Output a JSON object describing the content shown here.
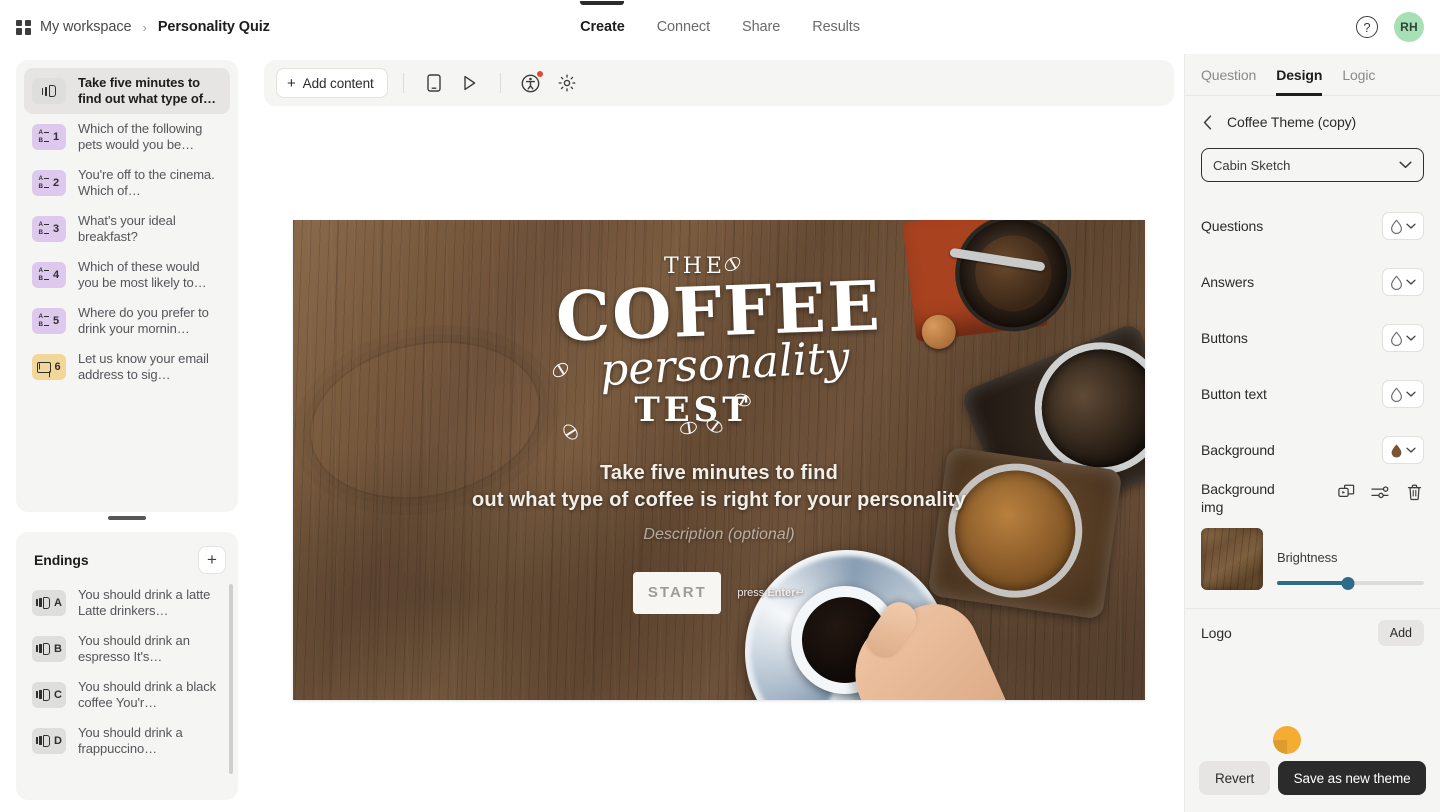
{
  "header": {
    "workspace": "My workspace",
    "separator": "›",
    "project": "Personality Quiz",
    "tabs": [
      {
        "label": "Create",
        "active": true
      },
      {
        "label": "Connect",
        "active": false
      },
      {
        "label": "Share",
        "active": false
      },
      {
        "label": "Results",
        "active": false
      }
    ],
    "help_glyph": "?",
    "avatar_initials": "RH",
    "avatar_color": "#a8e0b6"
  },
  "sidebar": {
    "questions": [
      {
        "badge": "",
        "icon": "welcome-slide-icon",
        "text": "Take five minutes to find out what type of…",
        "selected": true,
        "badge_style": "grey"
      },
      {
        "badge": "1",
        "icon": "multiple-choice-icon",
        "text": "Which of the following pets would you be…",
        "selected": false,
        "badge_style": "lilac"
      },
      {
        "badge": "2",
        "icon": "multiple-choice-icon",
        "text": "You're off to the cinema. Which of…",
        "selected": false,
        "badge_style": "lilac"
      },
      {
        "badge": "3",
        "icon": "multiple-choice-icon",
        "text": "What's your ideal breakfast?",
        "selected": false,
        "badge_style": "lilac"
      },
      {
        "badge": "4",
        "icon": "multiple-choice-icon",
        "text": "Which of these would you be most likely to…",
        "selected": false,
        "badge_style": "lilac"
      },
      {
        "badge": "5",
        "icon": "multiple-choice-icon",
        "text": "Where do you prefer to drink your mornin…",
        "selected": false,
        "badge_style": "lilac"
      },
      {
        "badge": "6",
        "icon": "email-icon",
        "text": "Let us know your email address to sig…",
        "selected": false,
        "badge_style": "amber"
      }
    ],
    "endings": {
      "title": "Endings",
      "add_label": "+",
      "items": [
        {
          "badge": "A",
          "text": "You should drink a latte Latte drinkers…"
        },
        {
          "badge": "B",
          "text": "You should drink an espresso It's…"
        },
        {
          "badge": "C",
          "text": "You should drink a black coffee You'r…"
        },
        {
          "badge": "D",
          "text": "You should drink a frappuccino…"
        }
      ]
    }
  },
  "toolbar": {
    "add_content_label": "Add content",
    "add_content_plus": "+",
    "icons": [
      {
        "name": "device-preview-icon"
      },
      {
        "name": "play-preview-icon"
      },
      {
        "name": "accessibility-icon",
        "badge": true
      },
      {
        "name": "settings-gear-icon"
      }
    ]
  },
  "slide": {
    "logo_the": "THE",
    "logo_coffee": "COFFEE",
    "logo_personality": "personality",
    "logo_test": "TEST",
    "headline_line1": "Take five minutes to find",
    "headline_line2": "out what type of coffee is right for your personality",
    "description_placeholder": "Description (optional)",
    "start_label": "START",
    "press_enter_prefix": "press ",
    "press_enter_key": "Enter",
    "press_enter_symbol": "↵"
  },
  "design_panel": {
    "tabs": [
      {
        "label": "Question",
        "active": false
      },
      {
        "label": "Design",
        "active": true
      },
      {
        "label": "Logic",
        "active": false
      }
    ],
    "back_chevron": "‹",
    "theme_name": "Coffee Theme (copy)",
    "font": {
      "value": "Cabin Sketch",
      "chevron": "⌄"
    },
    "options": [
      {
        "label": "Questions",
        "color": "none",
        "icon": "droplet-outline-icon"
      },
      {
        "label": "Answers",
        "color": "none",
        "icon": "droplet-outline-icon"
      },
      {
        "label": "Buttons",
        "color": "none",
        "icon": "droplet-outline-icon"
      },
      {
        "label": "Button text",
        "color": "none",
        "icon": "droplet-outline-icon"
      },
      {
        "label": "Background",
        "color": "#7b5433",
        "icon": "droplet-filled-icon"
      }
    ],
    "background_image": {
      "title": "Background img",
      "actions": [
        "replace-media-icon",
        "adjust-settings-icon",
        "delete-icon"
      ],
      "brightness_label": "Brightness",
      "brightness_value": 48
    },
    "logo": {
      "label": "Logo",
      "add_label": "Add"
    },
    "footer": {
      "revert_label": "Revert",
      "save_label": "Save as new theme"
    }
  }
}
